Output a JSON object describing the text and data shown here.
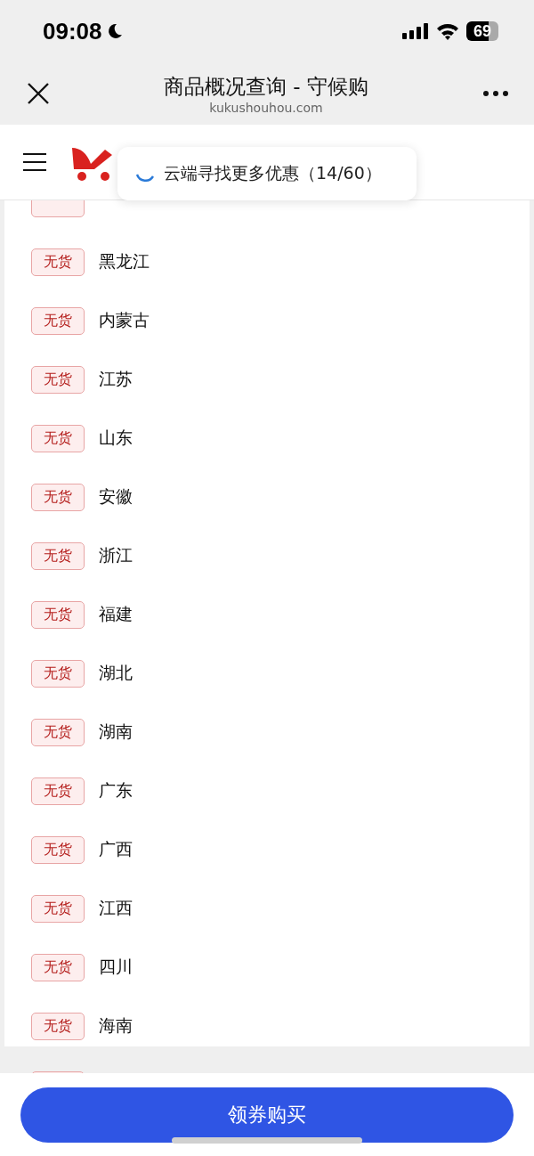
{
  "status_bar": {
    "time": "09:08",
    "battery": "69"
  },
  "nav_bar": {
    "title": "商品概况查询 - 守候购",
    "url": "kukushouhou.com"
  },
  "toast": {
    "text": "云端寻找更多优惠（14/60）"
  },
  "regions": [
    {
      "status": "无货",
      "name": "黑龙江"
    },
    {
      "status": "无货",
      "name": "内蒙古"
    },
    {
      "status": "无货",
      "name": "江苏"
    },
    {
      "status": "无货",
      "name": "山东"
    },
    {
      "status": "无货",
      "name": "安徽"
    },
    {
      "status": "无货",
      "name": "浙江"
    },
    {
      "status": "无货",
      "name": "福建"
    },
    {
      "status": "无货",
      "name": "湖北"
    },
    {
      "status": "无货",
      "name": "湖南"
    },
    {
      "status": "无货",
      "name": "广东"
    },
    {
      "status": "无货",
      "name": "广西"
    },
    {
      "status": "无货",
      "name": "江西"
    },
    {
      "status": "无货",
      "name": "四川"
    },
    {
      "status": "无货",
      "name": "海南"
    }
  ],
  "buy_button": {
    "label": "领券购买"
  }
}
